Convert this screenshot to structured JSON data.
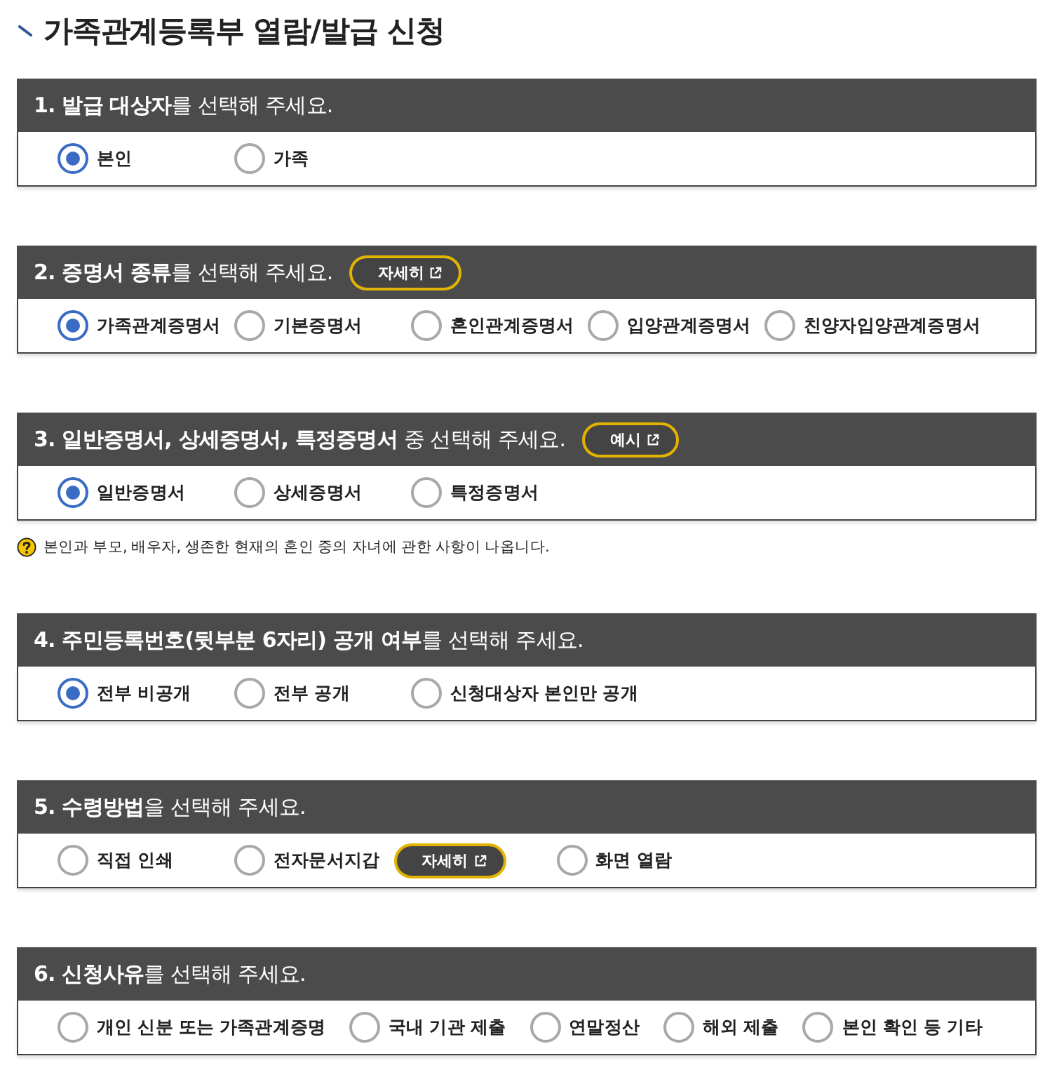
{
  "page": {
    "title": "가족관계등록부 열람/발급 신청"
  },
  "sections": [
    {
      "heading": "**1. 발급 대상자**를 선택해 주세요.",
      "kind": "columns",
      "options": [
        {
          "label": "본인",
          "selected": true
        },
        {
          "label": "가족",
          "selected": false
        }
      ]
    },
    {
      "heading": "**2. 증명서 종류**를 선택해 주세요.",
      "heading_button": {
        "label": "자세히"
      },
      "kind": "columns",
      "options": [
        {
          "label": "가족관계증명서",
          "selected": true
        },
        {
          "label": "기본증명서",
          "selected": false
        },
        {
          "label": "혼인관계증명서",
          "selected": false
        },
        {
          "label": "입양관계증명서",
          "selected": false
        },
        {
          "label": "친양자입양관계증명서",
          "selected": false
        }
      ]
    },
    {
      "heading": "**3. 일반증명서, 상세증명서, 특정증명서** 중 선택해 주세요.",
      "heading_button": {
        "label": "예시"
      },
      "kind": "columns",
      "options": [
        {
          "label": "일반증명서",
          "selected": true
        },
        {
          "label": "상세증명서",
          "selected": false
        },
        {
          "label": "특정증명서",
          "selected": false
        }
      ],
      "note": "본인과 부모, 배우자, 생존한 현재의 혼인 중의 자녀에 관한 사항이 나옵니다."
    },
    {
      "heading": "**4. 주민등록번호(뒷부분 6자리) 공개 여부**를 선택해 주세요.",
      "kind": "columns",
      "options": [
        {
          "label": "전부 비공개",
          "selected": true
        },
        {
          "label": "전부 공개",
          "selected": false
        },
        {
          "label": "신청대상자 본인만 공개",
          "selected": false
        }
      ]
    },
    {
      "heading": "**5. 수령방법**을 선택해 주세요.",
      "kind": "columns",
      "options": [
        {
          "label": "직접 인쇄",
          "selected": false
        },
        {
          "label": "전자문서지갑",
          "selected": false,
          "button": {
            "label": "자세히"
          }
        },
        {
          "label": "화면 열람",
          "selected": false
        }
      ]
    },
    {
      "heading": "**6. 신청사유**를 선택해 주세요.",
      "kind": "inline",
      "options": [
        {
          "label": "개인 신분 또는 가족관계증명",
          "selected": false
        },
        {
          "label": "국내 기관 제출",
          "selected": false
        },
        {
          "label": "연말정산",
          "selected": false
        },
        {
          "label": "해외 제출",
          "selected": false
        },
        {
          "label": "본인 확인 등 기타",
          "selected": false
        }
      ]
    }
  ]
}
